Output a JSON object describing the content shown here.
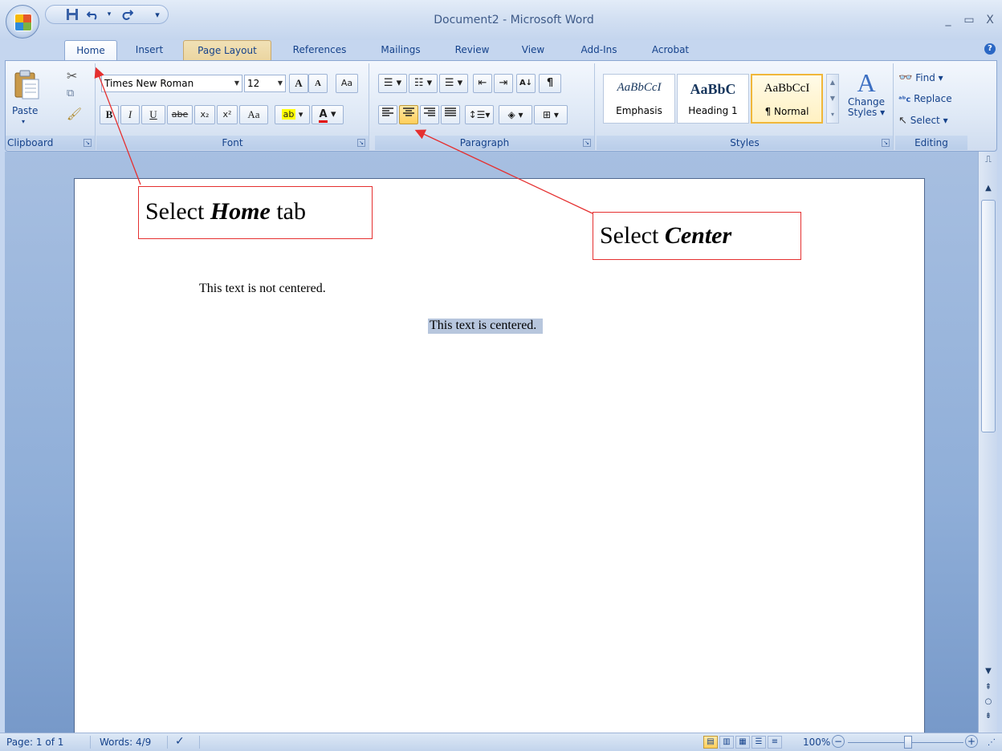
{
  "window": {
    "title": "Document2 - Microsoft Word",
    "minimize": "_",
    "maximize": "▭",
    "close": "X"
  },
  "qat": {
    "save_icon": "save-icon",
    "undo_icon": "undo-icon",
    "redo_icon": "redo-icon",
    "customize": "▾"
  },
  "tabs": [
    {
      "label": "Home"
    },
    {
      "label": "Insert"
    },
    {
      "label": "Page Layout"
    },
    {
      "label": "References"
    },
    {
      "label": "Mailings"
    },
    {
      "label": "Review"
    },
    {
      "label": "View"
    },
    {
      "label": "Add-Ins"
    },
    {
      "label": "Acrobat"
    }
  ],
  "ribbon": {
    "clipboard": {
      "label": "Clipboard",
      "paste": "Paste"
    },
    "font": {
      "label": "Font",
      "family": "Times New Roman",
      "size": "12",
      "grow": "A",
      "shrink": "A",
      "bold": "B",
      "italic": "I",
      "underline": "U",
      "strike": "abe",
      "subscript": "x₂",
      "superscript": "x²",
      "case": "Aa",
      "highlight": "ab",
      "color": "A"
    },
    "paragraph": {
      "label": "Paragraph",
      "sort": "A↓",
      "show": "¶"
    },
    "styles": {
      "label": "Styles",
      "items": [
        {
          "sample": "AaBbCcI",
          "name": "Emphasis"
        },
        {
          "sample": "AaBbC",
          "name": "Heading 1"
        },
        {
          "sample": "AaBbCcI",
          "name": "¶ Normal"
        }
      ],
      "change_styles": "Change",
      "change_styles2": "Styles ▾"
    },
    "editing": {
      "label": "Editing",
      "find": "Find ▾",
      "replace": "Replace",
      "select": "Select ▾"
    }
  },
  "document": {
    "line1": "This text is not centered.",
    "line2": "This text is centered."
  },
  "callouts": {
    "home_prefix": "Select ",
    "home_bold": "Home",
    "home_suffix": " tab",
    "center_prefix": "Select ",
    "center_bold": "Center"
  },
  "statusbar": {
    "page": "Page: 1 of 1",
    "words": "Words: 4/9",
    "zoom": "100%",
    "zoom_minus": "−",
    "zoom_plus": "+"
  },
  "colors": {
    "accent": "#15428b",
    "callout_border": "#e53030",
    "selection": "#b7c6dd",
    "active_button": "#ffcf5a"
  }
}
